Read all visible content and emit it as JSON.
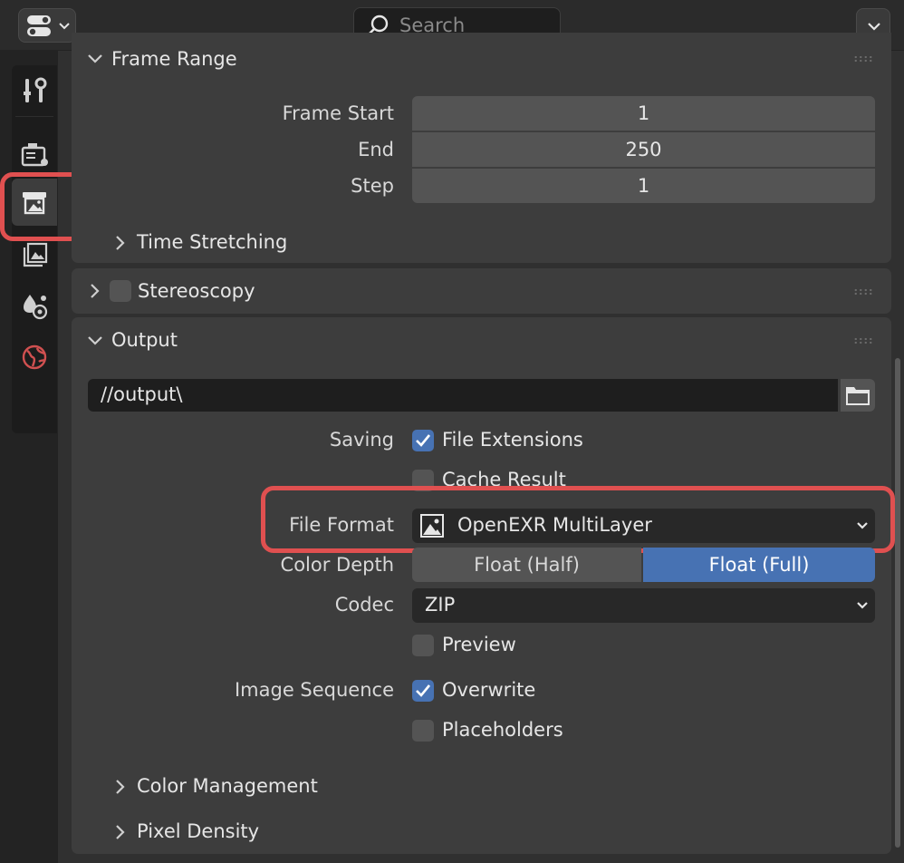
{
  "header": {
    "search_placeholder": "Search"
  },
  "sidebar": {
    "tabs": [
      {
        "name": "tool",
        "icon": "tool-icon"
      },
      {
        "name": "render",
        "icon": "render-icon"
      },
      {
        "name": "output",
        "icon": "output-icon",
        "active": true
      },
      {
        "name": "view-layer",
        "icon": "view-layer-icon"
      },
      {
        "name": "scene",
        "icon": "scene-icon"
      },
      {
        "name": "world",
        "icon": "world-icon"
      }
    ]
  },
  "frame_range": {
    "title": "Frame Range",
    "frame_start_label": "Frame Start",
    "frame_start_value": "1",
    "end_label": "End",
    "end_value": "250",
    "step_label": "Step",
    "step_value": "1",
    "time_stretching_label": "Time Stretching"
  },
  "stereoscopy": {
    "title": "Stereoscopy",
    "checked": false
  },
  "output": {
    "title": "Output",
    "path": "//output\\",
    "saving_label": "Saving",
    "file_extensions_label": "File Extensions",
    "file_extensions_checked": true,
    "cache_result_label": "Cache Result",
    "cache_result_checked": false,
    "file_format_label": "File Format",
    "file_format_value": "OpenEXR MultiLayer",
    "color_depth_label": "Color Depth",
    "color_depth_options": [
      "Float (Half)",
      "Float (Full)"
    ],
    "color_depth_selected": "Float (Full)",
    "codec_label": "Codec",
    "codec_value": "ZIP",
    "preview_label": "Preview",
    "preview_checked": false,
    "image_sequence_label": "Image Sequence",
    "overwrite_label": "Overwrite",
    "overwrite_checked": true,
    "placeholders_label": "Placeholders",
    "placeholders_checked": false,
    "color_management_label": "Color Management",
    "pixel_density_label": "Pixel Density"
  },
  "colors": {
    "accent": "#4772b3",
    "highlight": "#e05050",
    "panel": "#3d3d3d",
    "background": "#303030"
  }
}
